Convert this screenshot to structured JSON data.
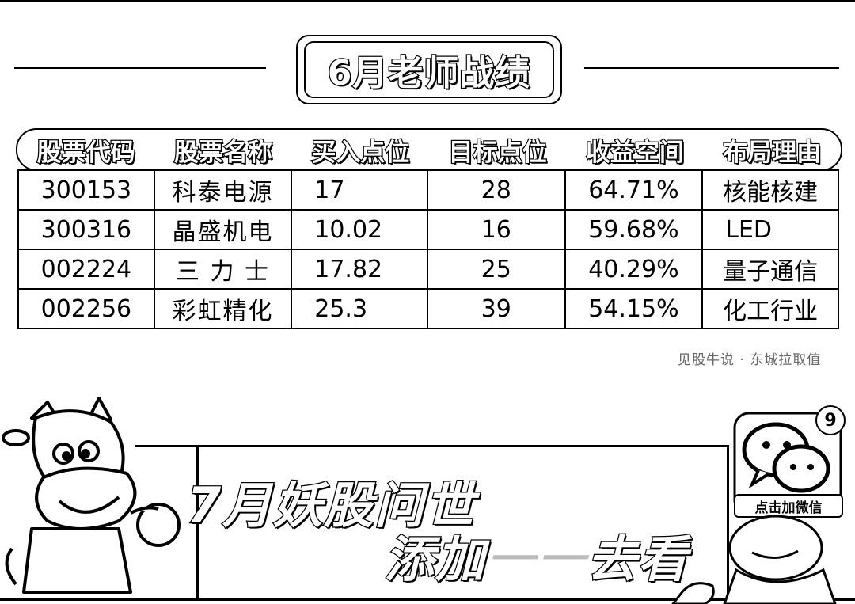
{
  "title": "6月老师战绩",
  "table": {
    "headers": [
      "股票代码",
      "股票名称",
      "买入点位",
      "目标点位",
      "收益空间",
      "布局理由"
    ],
    "rows": [
      [
        "300153",
        "科泰电源",
        "17",
        "28",
        "64.71%",
        "核能核建"
      ],
      [
        "300316",
        "晶盛机电",
        "10.02",
        "16",
        "59.68%",
        "LED"
      ],
      [
        "002224",
        "三 力 士",
        "17.82",
        "25",
        "40.29%",
        "量子通信"
      ],
      [
        "002256",
        "彩虹精化",
        "25.3",
        "39",
        "54.15%",
        "化工行业"
      ]
    ]
  },
  "source_note": "见股牛说 · 东城拉取值",
  "banner": {
    "line1": "7月妖股问世",
    "line2_a": "添加",
    "line2_b": "一一",
    "line2_c": "去看"
  },
  "wechat": {
    "label": "点击加微信",
    "badge": "9"
  },
  "icons": [
    "cow-mascot-icon",
    "wechat-icon",
    "person-illustration-icon"
  ]
}
